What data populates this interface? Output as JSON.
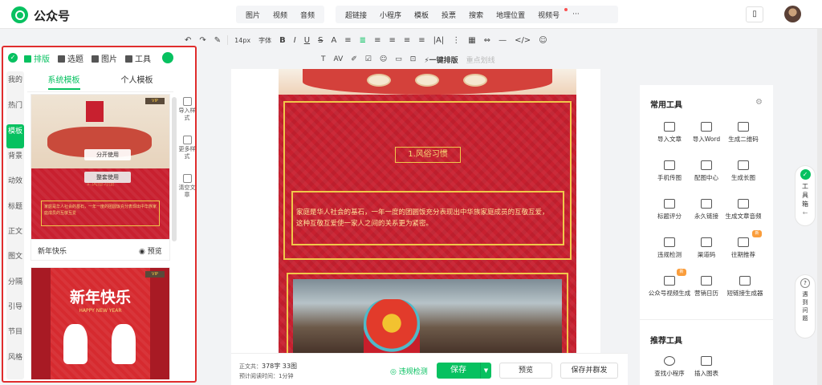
{
  "app": {
    "name": "公众号"
  },
  "insert_menu": {
    "group1": [
      "图片",
      "视频",
      "音频"
    ],
    "group2": [
      "超链接",
      "小程序",
      "模板",
      "投票",
      "搜索",
      "地理位置",
      "视频号",
      "···"
    ]
  },
  "toolbar1": [
    "↶",
    "↷",
    "✎",
    "14px",
    "字体",
    "B",
    "I",
    "U",
    "S",
    "A",
    "≡",
    "≣",
    "≡",
    "≡",
    "≡",
    "≡",
    "|A|",
    "⋮",
    "▦",
    "⇔",
    "—",
    "</>",
    "☺"
  ],
  "toolbar2": [
    "T",
    "AV",
    "✐",
    "☑",
    "☺",
    "▭",
    "⊡",
    "一键排版",
    "重点划线"
  ],
  "left_panel": {
    "tabs": [
      "排版",
      "选题",
      "图片",
      "工具"
    ],
    "categories": [
      "我的",
      "热门",
      "模板",
      "背景",
      "动效",
      "标题",
      "正文",
      "图文",
      "分隔",
      "引导",
      "节目",
      "风格"
    ],
    "subtabs": [
      "系统模板",
      "个人模板"
    ],
    "side_tools": [
      "导入样式",
      "更多样式",
      "清空文章"
    ],
    "card1": {
      "btn_split": "分开使用",
      "btn_whole": "整套使用",
      "name": "新年快乐",
      "preview": "预览",
      "excerpt": "家庭是华人社会的基石，一年一度的团圆饭充分表现出中华族家庭成员的互敬互爱",
      "heading": "1.风俗习惯"
    },
    "card2": {
      "title": "新年快乐",
      "subtitle": "HAPPY NEW YEAR"
    }
  },
  "article": {
    "section_title": "1.风俗习惯",
    "paragraph": "家庭是华人社会的基石，一年一度的团圆饭充分表现出中华族家庭成员的互敬互爱，这种互敬互爱使一家人之间的关系更为紧密。"
  },
  "bottom_bar": {
    "word_count_label": "正文共：",
    "word_count": "378字 33图",
    "read_time_label": "预计阅读时间：",
    "read_time": "1分钟",
    "check": "违规检测",
    "save": "保存",
    "preview": "预览",
    "save_send": "保存并群发"
  },
  "right_panel": {
    "common_title": "常用工具",
    "common_tools": [
      "导入文章",
      "导入Word",
      "生成二维码",
      "手机传图",
      "配图中心",
      "生成长图",
      "标题评分",
      "永久链接",
      "生成文章音频",
      "违规检测",
      "渠道码",
      "往期推荐",
      "公众号视频生成",
      "营销日历",
      "短链接生成器"
    ],
    "recommend_title": "推荐工具",
    "recommend_tools": [
      "查找小程序",
      "插入图表"
    ],
    "new_badge": "新"
  },
  "float": {
    "toolbox": "工具箱",
    "help": "遇到问题"
  },
  "colors": {
    "brand_green": "#07c160",
    "festive_red": "#c8202f",
    "gold": "#f0c84a",
    "highlight_border": "#e02d2d"
  }
}
